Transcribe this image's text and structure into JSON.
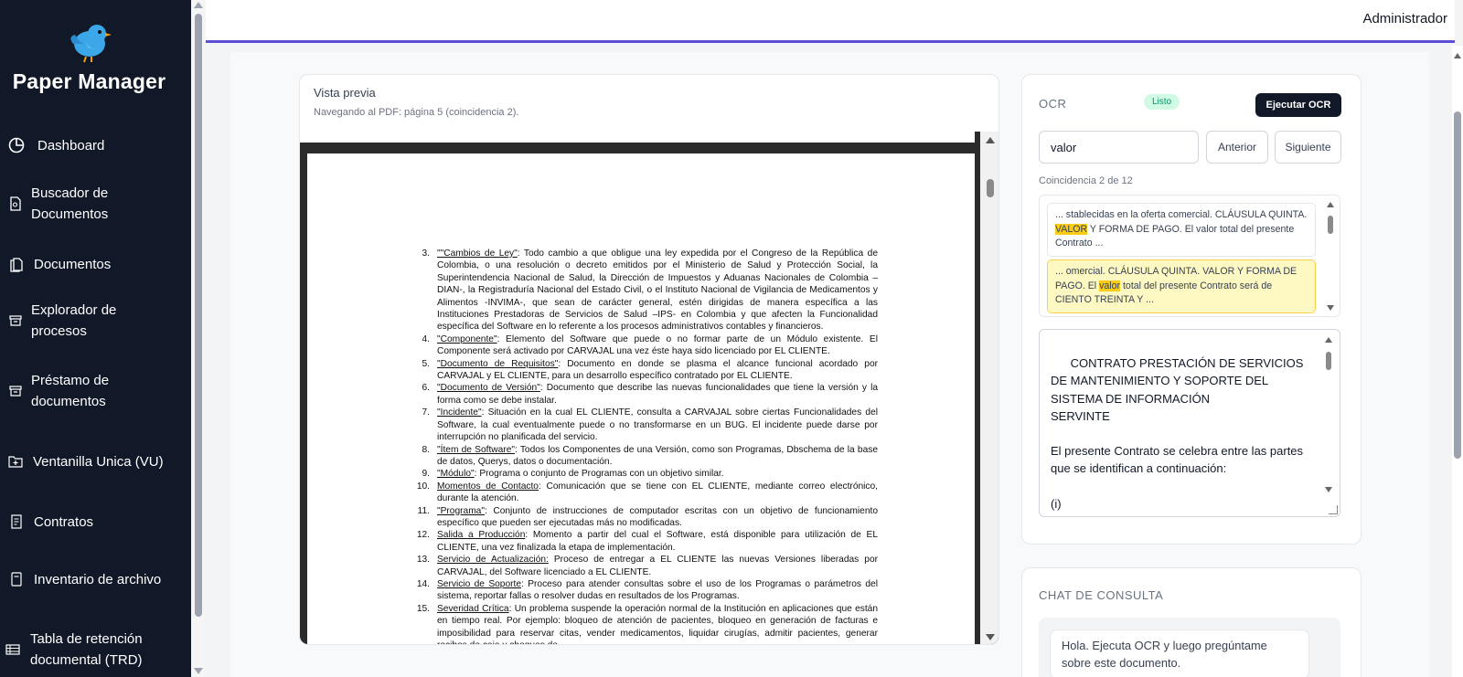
{
  "app": {
    "title": "Paper Manager"
  },
  "header": {
    "user": "Administrador"
  },
  "sidebar": {
    "items": [
      {
        "label": "Dashboard",
        "icon": "pie-chart-icon"
      },
      {
        "label": "Buscador de Documentos",
        "icon": "file-search-icon"
      },
      {
        "label": "Documentos",
        "icon": "files-icon"
      },
      {
        "label": "Explorador de procesos",
        "icon": "archive-icon"
      },
      {
        "label": "Préstamo de documentos",
        "icon": "archive-icon"
      },
      {
        "label": "Ventanilla Unica (VU)",
        "icon": "folder-plus-icon"
      },
      {
        "label": "Contratos",
        "icon": "contract-icon"
      },
      {
        "label": "Inventario de archivo",
        "icon": "inventory-icon"
      },
      {
        "label": "Tabla de retención documental (TRD)",
        "icon": "table-icon"
      }
    ]
  },
  "preview": {
    "title": "Vista previa",
    "subtitle": "Navegando al PDF: página 5 (coincidencia 2).",
    "document_items": [
      {
        "num": "3.",
        "term": "\"\"Cambios de Ley\"",
        "text": ": Todo cambio a que obligue una ley expedida por el Congreso de la República de Colombia, o una resolución o decreto emitidos por el Ministerio de Salud y Protección Social, la Superintendencia Nacional de Salud, la Dirección de Impuestos y Aduanas Nacionales de Colombia –DIAN-, la Registraduría Nacional del Estado Civil, o el Instituto Nacional de Vigilancia de Medicamentos y Alimentos -INVIMA-, que sean de carácter general, estén dirigidas de manera específica a las Instituciones Prestadoras de Servicios de Salud –IPS- en Colombia y que afecten la Funcionalidad específica del Software en lo referente a los procesos administrativos contables y financieros."
      },
      {
        "num": "4.",
        "term": "\"Componente\"",
        "text": ": Elemento del Software que puede o no formar parte de un Módulo existente. El Componente será activado por CARVAJAL una vez éste haya sido licenciado por EL CLIENTE."
      },
      {
        "num": "5.",
        "term": "\"Documento de Requisitos\"",
        "text": ": Documento en donde se plasma el alcance funcional acordado por CARVAJAL y EL CLIENTE, para un desarrollo específico contratado por EL CLIENTE."
      },
      {
        "num": "6.",
        "term": "\"Documento de Versión\"",
        "text": ": Documento que describe las nuevas funcionalidades que tiene la versión y la forma como se debe instalar."
      },
      {
        "num": "7.",
        "term": "\"Incidente\"",
        "text": ": Situación en la cual EL CLIENTE, consulta a CARVAJAL sobre ciertas Funcionalidades del Software, la cual eventualmente puede o no transformarse en un BUG. El incidente puede darse por interrupción no planificada del servicio."
      },
      {
        "num": "8.",
        "term": "\"Ítem de Software\"",
        "text": ": Todos los Componentes de una Versión, como son Programas, Dbschema de la base de datos, Querys, datos o documentación."
      },
      {
        "num": "9.",
        "term": "\"Módulo\"",
        "text": ": Programa o conjunto de Programas con un objetivo similar."
      },
      {
        "num": "10.",
        "term": "Momentos de Contacto",
        "text": ": Comunicación que se tiene con EL CLIENTE, mediante correo electrónico, durante la atención."
      },
      {
        "num": "11.",
        "term": "\"Programa\"",
        "text": ": Conjunto de instrucciones de computador escritas con un objetivo de funcionamiento específico que pueden ser ejecutadas más no modificadas."
      },
      {
        "num": "12.",
        "term": "Salida a Producción",
        "text": ": Momento a partir del cual el Software, está disponible para utilización de EL CLIENTE, una vez finalizada la etapa de implementación."
      },
      {
        "num": "13.",
        "term": "Servicio de Actualización:",
        "text": " Proceso de entregar a EL CLIENTE las nuevas Versiones liberadas por CARVAJAL, del Software licenciado a EL CLIENTE."
      },
      {
        "num": "14.",
        "term": "Servicio de Soporte",
        "text": ": Proceso para atender consultas sobre el uso de los Programas o parámetros del sistema, reportar fallas o resolver dudas en resultados de los Programas."
      },
      {
        "num": "15.",
        "term": "Severidad Crítica",
        "text": ": Un problema suspende la operación normal de la Institución en aplicaciones que están en tiempo real. Por ejemplo: bloqueo de atención de pacientes, bloqueo en generación de facturas e imposibilidad para reservar citas, vender medicamentos, liquidar cirugías, admitir pacientes, generar recibos de caja y cheques de"
      }
    ]
  },
  "ocr": {
    "title": "OCR",
    "status": "Listo",
    "run_label": "Ejecutar OCR",
    "search_value": "valor",
    "prev_label": "Anterior",
    "next_label": "Siguiente",
    "match_count": "Coincidencia 2 de 12",
    "results": [
      {
        "before": "... stablecidas en la oferta comercial. CLÁUSULA QUINTA. ",
        "match": "VALOR",
        "after": " Y FORMA DE PAGO. El valor total del presente Contrato ..."
      },
      {
        "before": "... omercial. CLÁUSULA QUINTA. VALOR Y FORMA DE PAGO. El ",
        "match": "valor",
        "after": " total del presente Contrato será de CIENTO TREINTA Y ..."
      }
    ],
    "text": "CONTRATO PRESTACIÓN DE SERVICIOS DE MANTENIMIENTO Y SOPORTE DEL SISTEMA DE INFORMACIÓN\nSERVINTE\n\nEl presente Contrato se celebra entre las partes que se identifican a continuación:\n\n(i)\n\n(ii)"
  },
  "chat": {
    "title": "CHAT DE CONSULTA",
    "message": "Hola. Ejecuta OCR y luego pregúntame sobre este documento."
  }
}
